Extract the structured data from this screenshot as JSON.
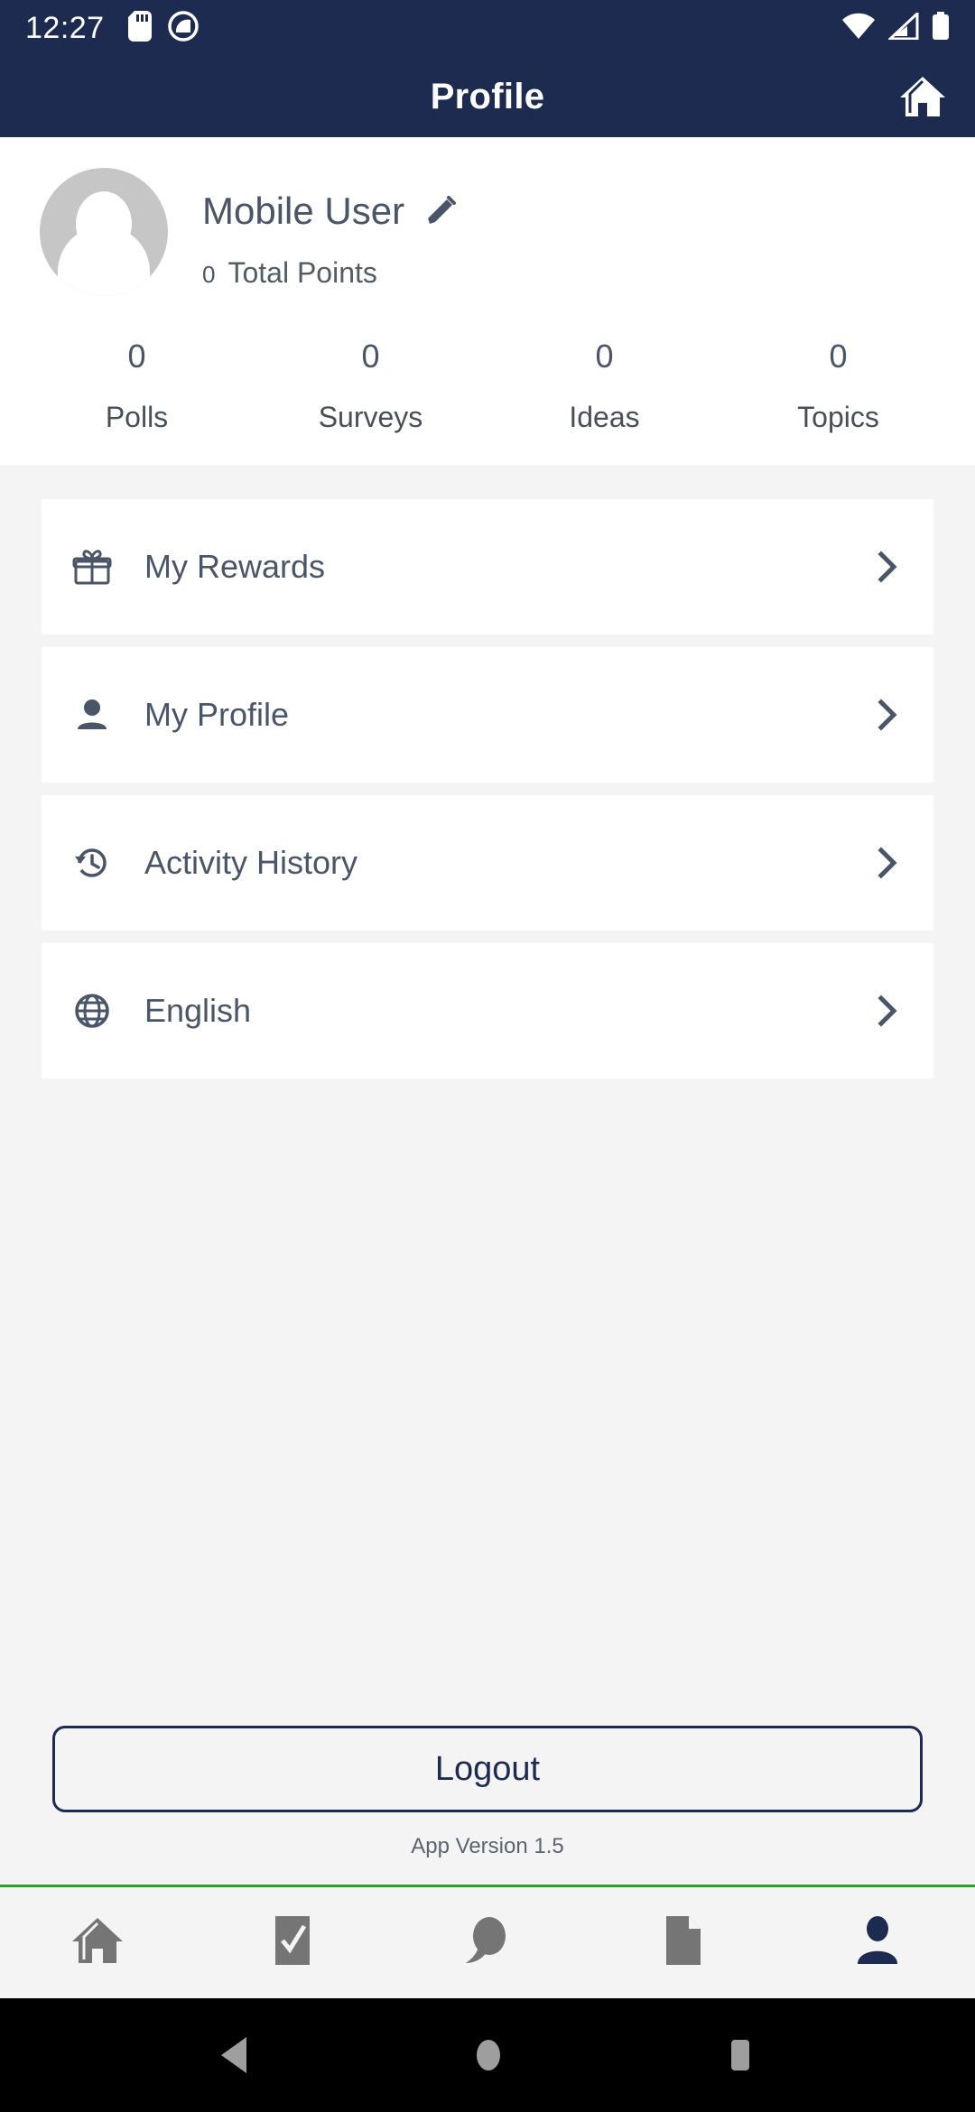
{
  "statusbar": {
    "time": "12:27",
    "icons_left": [
      "sd-card-icon",
      "do-not-disturb-icon"
    ],
    "icons_right": [
      "wifi-icon",
      "cellular-signal-icon",
      "battery-icon"
    ]
  },
  "appbar": {
    "title": "Profile",
    "home_icon": "home-icon"
  },
  "profile": {
    "avatar_icon": "avatar-placeholder-icon",
    "name": "Mobile User",
    "edit_icon": "pencil-edit-icon",
    "points_value": "0",
    "points_label": "Total Points",
    "stats": [
      {
        "value": "0",
        "label": "Polls"
      },
      {
        "value": "0",
        "label": "Surveys"
      },
      {
        "value": "0",
        "label": "Ideas"
      },
      {
        "value": "0",
        "label": "Topics"
      }
    ]
  },
  "menu": {
    "items": [
      {
        "label": "My Rewards",
        "icon": "gift-icon"
      },
      {
        "label": "My Profile",
        "icon": "person-icon"
      },
      {
        "label": "Activity History",
        "icon": "history-clock-icon"
      },
      {
        "label": "English",
        "icon": "globe-icon"
      }
    ]
  },
  "footer": {
    "logout_label": "Logout",
    "app_version": "App Version 1.5"
  },
  "bottomnav": {
    "items": [
      {
        "icon": "home-icon",
        "active": false
      },
      {
        "icon": "checkbox-icon",
        "active": false
      },
      {
        "icon": "chat-icon",
        "active": false
      },
      {
        "icon": "document-icon",
        "active": false
      },
      {
        "icon": "profile-icon",
        "active": true
      }
    ]
  },
  "androidnav": {
    "back": "back-triangle-icon",
    "home": "home-circle-icon",
    "recents": "recents-square-icon"
  },
  "colors": {
    "header": "#1d2b50",
    "accent_green": "#27a327",
    "text": "#4a5568",
    "background": "#f4f4f4",
    "card": "#ffffff",
    "nav_inactive": "#757575"
  }
}
